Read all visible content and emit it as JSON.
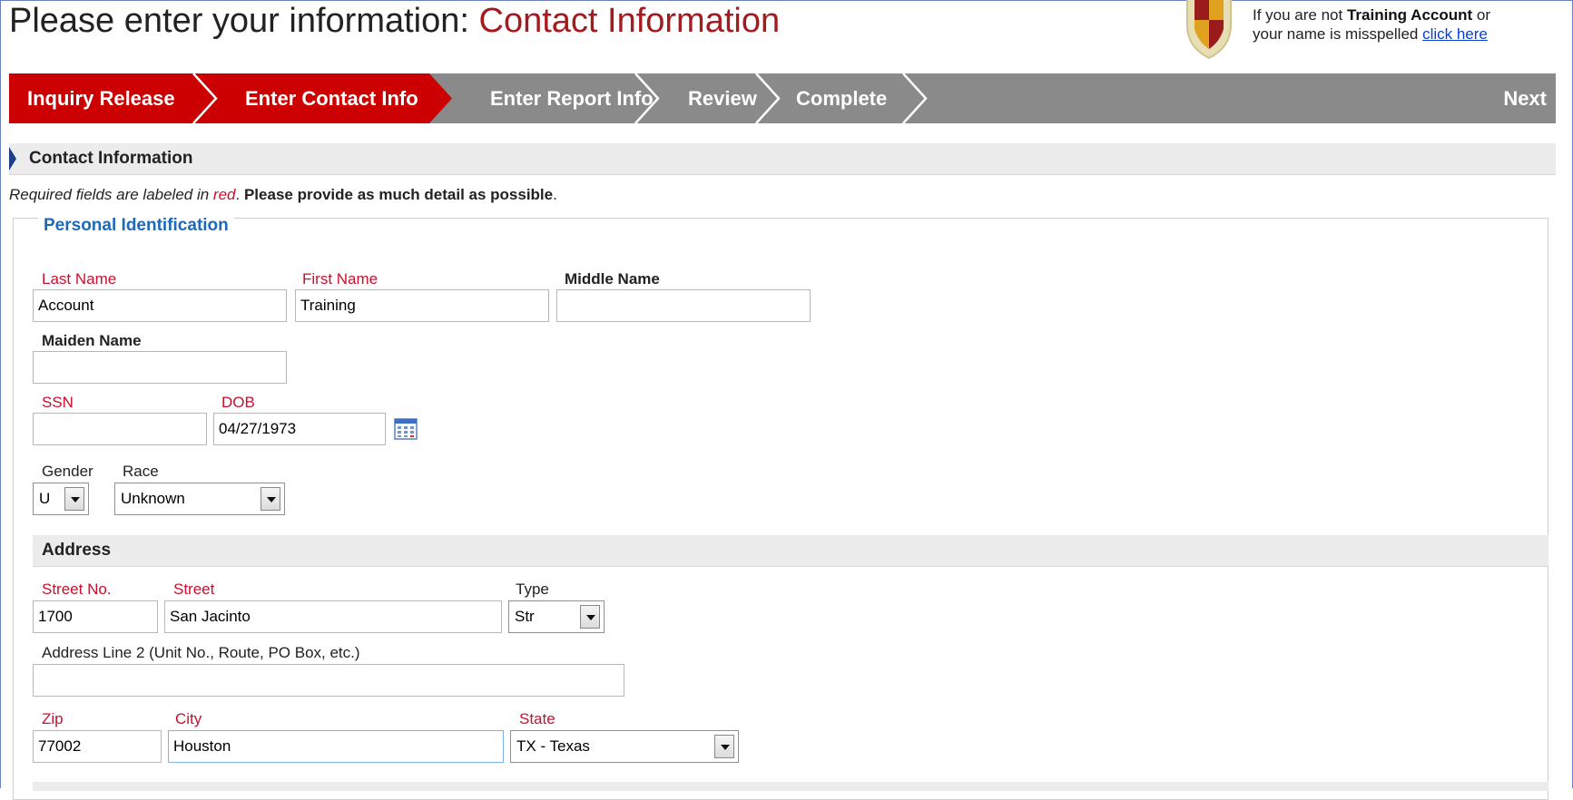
{
  "header": {
    "title_prefix": "Please enter your information: ",
    "title_section": "Contact Information",
    "user_line1_pre": "If you are not ",
    "user_name": "Training Account",
    "user_line1_post": " or",
    "user_line2_pre": "your name is misspelled ",
    "user_link": "click here"
  },
  "steps": [
    {
      "label": "Inquiry Release",
      "state": "done"
    },
    {
      "label": "Enter Contact Info",
      "state": "active"
    },
    {
      "label": "Enter Report Info",
      "state": "pending"
    },
    {
      "label": "Review",
      "state": "pending"
    },
    {
      "label": "Complete",
      "state": "pending"
    }
  ],
  "next_label": "Next",
  "section_title": "Contact Information",
  "note": {
    "italic_pre": "Required fields are labeled in ",
    "italic_red": "red",
    "period": ".",
    "bold": "Please provide as much detail as possible",
    "end": "."
  },
  "personal": {
    "legend": "Personal Identification",
    "last_name": {
      "label": "Last Name",
      "value": "Account"
    },
    "first_name": {
      "label": "First Name",
      "value": "Training"
    },
    "middle_name": {
      "label": "Middle Name",
      "value": ""
    },
    "maiden_name": {
      "label": "Maiden Name",
      "value": ""
    },
    "ssn": {
      "label": "SSN",
      "value": ""
    },
    "dob": {
      "label": "DOB",
      "value": "04/27/1973"
    },
    "gender": {
      "label": "Gender",
      "value": "U"
    },
    "race": {
      "label": "Race",
      "value": "Unknown"
    }
  },
  "address": {
    "title": "Address",
    "street_no": {
      "label": "Street No.",
      "value": "1700"
    },
    "street": {
      "label": "Street",
      "value": "San Jacinto"
    },
    "type": {
      "label": "Type",
      "value": "Str"
    },
    "line2": {
      "label": "Address Line 2 (Unit No., Route, PO Box, etc.)",
      "value": ""
    },
    "zip": {
      "label": "Zip",
      "value": "77002"
    },
    "city": {
      "label": "City",
      "value": "Houston"
    },
    "state": {
      "label": "State",
      "value": "TX - Texas"
    }
  },
  "colors": {
    "active_step": "#cc0000",
    "pending_step": "#8a8a8a",
    "required_label": "#c8102e",
    "legend": "#1e6ab8",
    "title_accent": "#a31a1f"
  },
  "icons": [
    "shield-logo",
    "chevron-separator-icon",
    "calendar-icon",
    "dropdown-arrow-icon",
    "section-marker-icon"
  ]
}
